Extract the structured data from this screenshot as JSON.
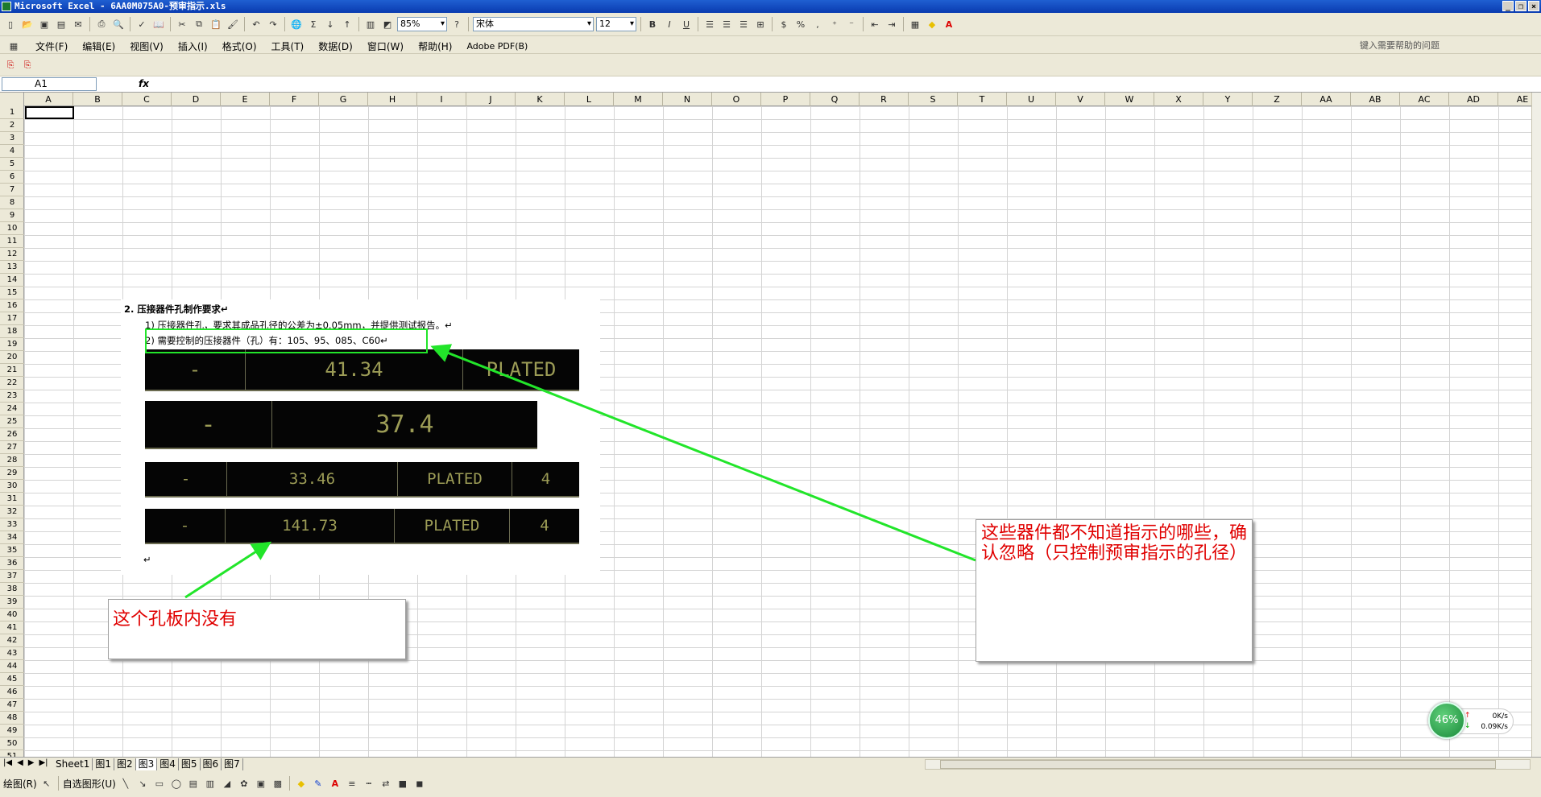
{
  "window": {
    "title": "Microsoft Excel - 6AA0M075A0-预审指示.xls",
    "buttons": [
      "_",
      "❐",
      "×"
    ]
  },
  "toolbar": {
    "zoom": "85%",
    "font_name": "宋体",
    "font_size": "12"
  },
  "menu": {
    "items": [
      "文件(F)",
      "编辑(E)",
      "视图(V)",
      "插入(I)",
      "格式(O)",
      "工具(T)",
      "数据(D)",
      "窗口(W)",
      "帮助(H)",
      "Adobe PDF(B)"
    ],
    "help_placeholder": "键入需要帮助的问题"
  },
  "formula": {
    "name_box": "A1",
    "fx": "fx"
  },
  "grid": {
    "columns": [
      "A",
      "B",
      "C",
      "D",
      "E",
      "F",
      "G",
      "H",
      "I",
      "J",
      "K",
      "L",
      "M",
      "N",
      "O",
      "P",
      "Q",
      "R",
      "S",
      "T",
      "U",
      "V",
      "W",
      "X",
      "Y",
      "Z",
      "AA",
      "AB",
      "AC",
      "AD",
      "AE"
    ],
    "rows": [
      "1",
      "2",
      "3",
      "4",
      "5",
      "6",
      "7",
      "8",
      "9",
      "10",
      "11",
      "12",
      "13",
      "14",
      "15",
      "16",
      "17",
      "18",
      "19",
      "20",
      "21",
      "22",
      "23",
      "24",
      "25",
      "26",
      "27",
      "28",
      "29",
      "30",
      "31",
      "32",
      "33",
      "34",
      "35",
      "36",
      "37",
      "38",
      "39",
      "40",
      "41",
      "42",
      "43",
      "44",
      "45",
      "46",
      "47",
      "48",
      "49",
      "50",
      "51"
    ]
  },
  "embedded_doc": {
    "heading": "2.    压接器件孔制作要求↵",
    "line1": "1) 压接器件孔，要求其成品孔径的公差为±0.05mm，并提供测试报告。↵",
    "line2": "2) 需要控制的压接器件（孔）有：105、95、085、C60↵",
    "rows": [
      {
        "cells": [
          "-",
          "41.34",
          "PLATED"
        ]
      },
      {
        "cells": [
          "-",
          "37.4"
        ]
      },
      {
        "cells": [
          "-",
          "33.46",
          "PLATED",
          "4"
        ]
      },
      {
        "cells": [
          "-",
          "141.73",
          "PLATED",
          "4"
        ]
      }
    ],
    "end_mark": "↵"
  },
  "callouts": {
    "left": "这个孔板内没有",
    "right": "这些器件都不知道指示的哪些，确认忽略（只控制预审指示的孔径）"
  },
  "sheets": {
    "nav": [
      "|◀",
      "◀",
      "▶",
      "▶|"
    ],
    "tabs": [
      "Sheet1",
      "图1",
      "图2",
      "图3",
      "图4",
      "图5",
      "图6",
      "图7"
    ],
    "active": "图3"
  },
  "drawing_toolbar": {
    "draw_label": "绘图(R)",
    "autoshape_label": "自选图形(U)"
  },
  "net_monitor": {
    "percent": "46%",
    "up": "0K/s",
    "down": "0.09K/s"
  },
  "colors": {
    "callout_text": "#e00000",
    "arrow": "#22e52a"
  }
}
